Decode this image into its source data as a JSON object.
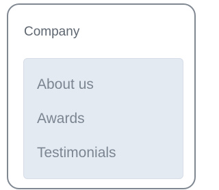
{
  "panel": {
    "title": "Company",
    "items": [
      {
        "label": "About us"
      },
      {
        "label": "Awards"
      },
      {
        "label": "Testimonials"
      }
    ]
  },
  "colors": {
    "border": "#7f8791",
    "title_text": "#5e6670",
    "submenu_bg": "#e4eaf2",
    "item_text": "#7b8591"
  }
}
